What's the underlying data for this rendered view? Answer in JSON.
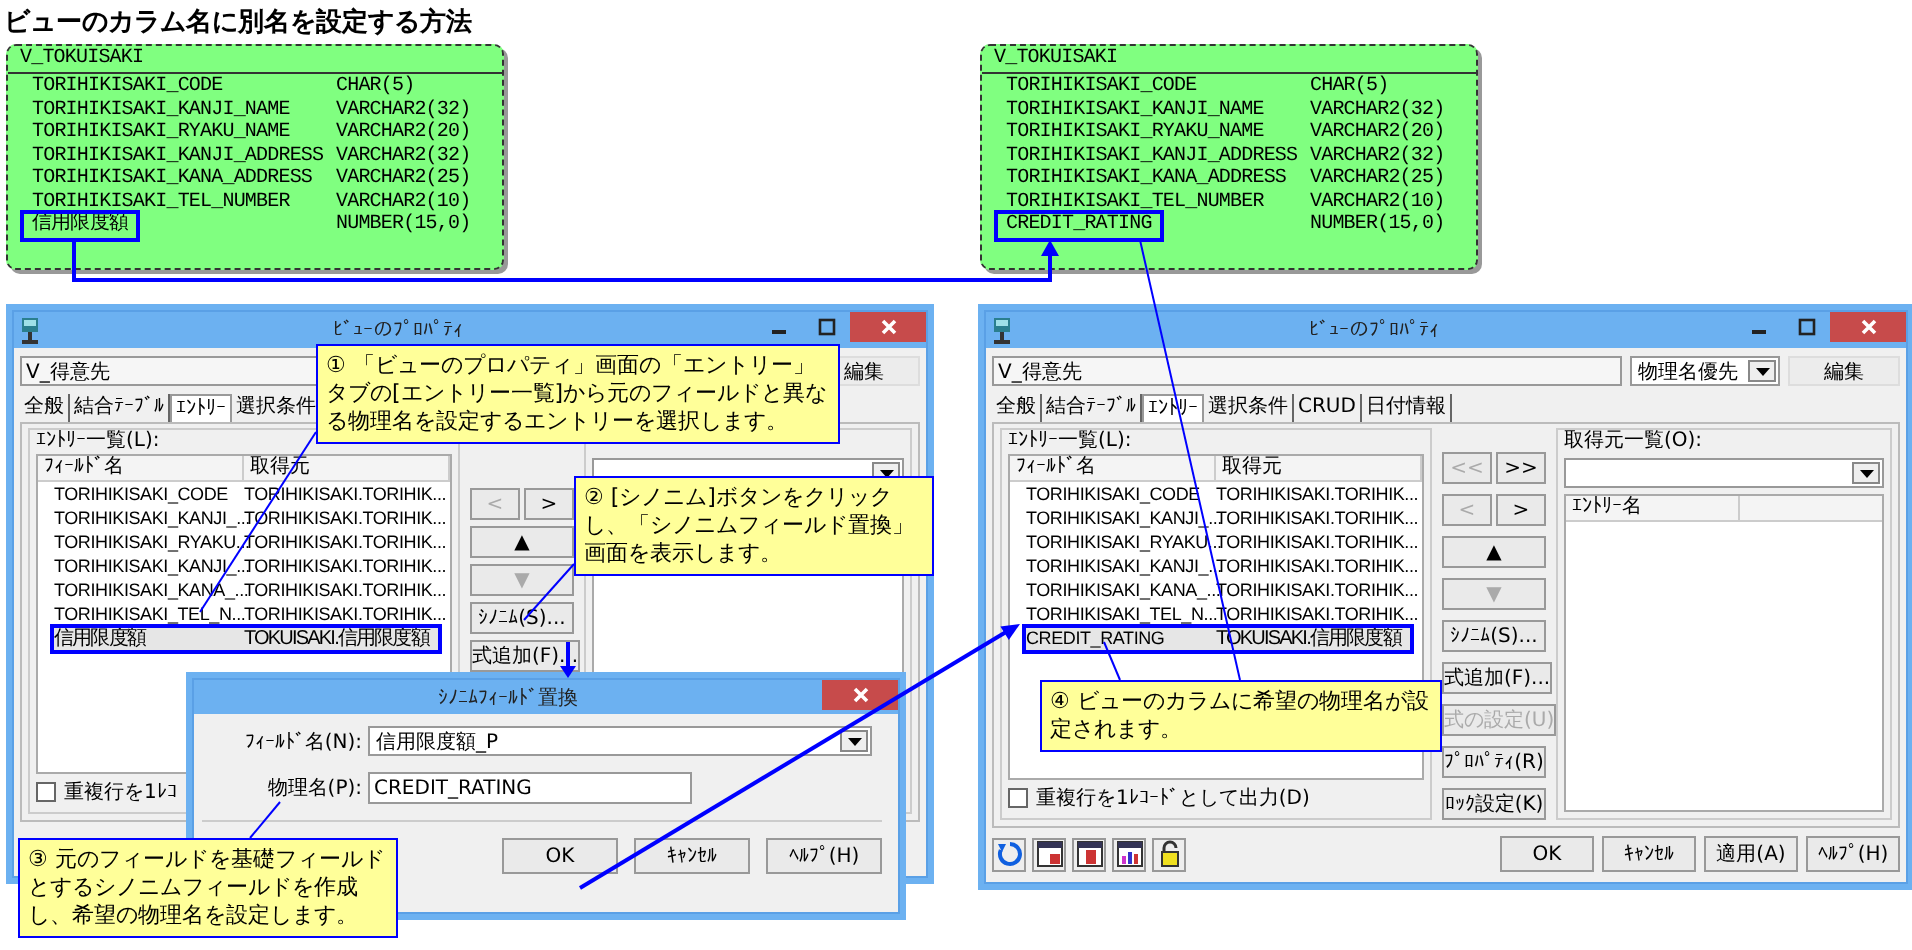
{
  "title": "ビューのカラム名に別名を設定する方法",
  "er_tables": [
    {
      "name": "V_TOKUISAKI",
      "columns": [
        {
          "name": "TORIHIKISAKI_CODE",
          "type": "CHAR(5)",
          "highlighted": false
        },
        {
          "name": "TORIHIKISAKI_KANJI_NAME",
          "type": "VARCHAR2(32)",
          "highlighted": false
        },
        {
          "name": "TORIHIKISAKI_RYAKU_NAME",
          "type": "VARCHAR2(20)",
          "highlighted": false
        },
        {
          "name": "TORIHIKISAKI_KANJI_ADDRESS",
          "type": "VARCHAR2(32)",
          "highlighted": false
        },
        {
          "name": "TORIHIKISAKI_KANA_ADDRESS",
          "type": "VARCHAR2(25)",
          "highlighted": false
        },
        {
          "name": "TORIHIKISAKI_TEL_NUMBER",
          "type": "VARCHAR2(10)",
          "highlighted": false
        },
        {
          "name": "信用限度額",
          "type": "NUMBER(15,0)",
          "highlighted": true
        }
      ]
    },
    {
      "name": "V_TOKUISAKI",
      "columns": [
        {
          "name": "TORIHIKISAKI_CODE",
          "type": "CHAR(5)",
          "highlighted": false
        },
        {
          "name": "TORIHIKISAKI_KANJI_NAME",
          "type": "VARCHAR2(32)",
          "highlighted": false
        },
        {
          "name": "TORIHIKISAKI_RYAKU_NAME",
          "type": "VARCHAR2(20)",
          "highlighted": false
        },
        {
          "name": "TORIHIKISAKI_KANJI_ADDRESS",
          "type": "VARCHAR2(32)",
          "highlighted": false
        },
        {
          "name": "TORIHIKISAKI_KANA_ADDRESS",
          "type": "VARCHAR2(25)",
          "highlighted": false
        },
        {
          "name": "TORIHIKISAKI_TEL_NUMBER",
          "type": "VARCHAR2(10)",
          "highlighted": false
        },
        {
          "name": "CREDIT_RATING",
          "type": "NUMBER(15,0)",
          "highlighted": true
        }
      ]
    }
  ],
  "dialogs": [
    {
      "title": "ﾋﾞｭｰのﾌﾟﾛﾊﾟﾃｨ",
      "view_name": "V_得意先",
      "edit_button": "編集",
      "tabs": [
        {
          "label": "全般",
          "selected": false
        },
        {
          "label": "結合ﾃｰﾌﾞﾙ",
          "selected": false
        },
        {
          "label": "ｴﾝﾄﾘｰ",
          "selected": true
        },
        {
          "label": "選択条件",
          "selected": false
        }
      ],
      "entry_group": {
        "label": "ｴﾝﾄﾘｰ一覧(L):",
        "columns": [
          "ﾌｨｰﾙﾄﾞ名",
          "取得元"
        ],
        "rows": [
          {
            "field": "TORIHIKISAKI_CODE",
            "source": "TORIHIKISAKI.TORIHIK...",
            "selected": false,
            "highlighted": false
          },
          {
            "field": "TORIHIKISAKI_KANJI_...",
            "source": "TORIHIKISAKI.TORIHIK...",
            "selected": false,
            "highlighted": false
          },
          {
            "field": "TORIHIKISAKI_RYAKU...",
            "source": "TORIHIKISAKI.TORIHIK...",
            "selected": false,
            "highlighted": false
          },
          {
            "field": "TORIHIKISAKI_KANJI_...",
            "source": "TORIHIKISAKI.TORIHIK...",
            "selected": false,
            "highlighted": false
          },
          {
            "field": "TORIHIKISAKI_KANA_...",
            "source": "TORIHIKISAKI.TORIHIK...",
            "selected": false,
            "highlighted": false
          },
          {
            "field": "TORIHIKISAKI_TEL_N...",
            "source": "TORIHIKISAKI.TORIHIK...",
            "selected": false,
            "highlighted": false
          },
          {
            "field": "信用限度額",
            "source": "TOKUISAKI.信用限度額",
            "selected": true,
            "highlighted": true
          }
        ],
        "checkbox": {
          "label": "重複行を1ﾚｺ",
          "checked": false
        }
      },
      "button_rows": [
        {
          "buttons": [
            {
              "label": "<",
              "disabled": true
            },
            {
              "label": ">",
              "disabled": false
            }
          ]
        },
        {
          "buttons": [
            {
              "label": "▲",
              "disabled": false
            }
          ]
        },
        {
          "buttons": [
            {
              "label": "▼",
              "disabled": true
            }
          ]
        },
        {
          "buttons": [
            {
              "label": "ｼﾉﾆﾑ(S)...",
              "disabled": false
            }
          ]
        },
        {
          "buttons": [
            {
              "label": "式追加(F)...",
              "disabled": false
            }
          ]
        }
      ]
    },
    {
      "title": "ﾋﾞｭｰのﾌﾟﾛﾊﾟﾃｨ",
      "view_name": "V_得意先",
      "mode": "物理名優先",
      "edit_button": "編集",
      "tabs": [
        {
          "label": "全般",
          "selected": false
        },
        {
          "label": "結合ﾃｰﾌﾞﾙ",
          "selected": false
        },
        {
          "label": "ｴﾝﾄﾘｰ",
          "selected": true
        },
        {
          "label": "選択条件",
          "selected": false
        },
        {
          "label": "CRUD",
          "selected": false
        },
        {
          "label": "日付情報",
          "selected": false
        }
      ],
      "entry_group": {
        "label": "ｴﾝﾄﾘｰ一覧(L):",
        "columns": [
          "ﾌｨｰﾙﾄﾞ名",
          "取得元"
        ],
        "rows": [
          {
            "field": "TORIHIKISAKI_CODE",
            "source": "TORIHIKISAKI.TORIHIK...",
            "selected": false,
            "highlighted": false
          },
          {
            "field": "TORIHIKISAKI_KANJI_...",
            "source": "TORIHIKISAKI.TORIHIK...",
            "selected": false,
            "highlighted": false
          },
          {
            "field": "TORIHIKISAKI_RYAKU...",
            "source": "TORIHIKISAKI.TORIHIK...",
            "selected": false,
            "highlighted": false
          },
          {
            "field": "TORIHIKISAKI_KANJI_...",
            "source": "TORIHIKISAKI.TORIHIK...",
            "selected": false,
            "highlighted": false
          },
          {
            "field": "TORIHIKISAKI_KANA_...",
            "source": "TORIHIKISAKI.TORIHIK...",
            "selected": false,
            "highlighted": false
          },
          {
            "field": "TORIHIKISAKI_TEL_N...",
            "source": "TORIHIKISAKI.TORIHIK...",
            "selected": false,
            "highlighted": false
          },
          {
            "field": "CREDIT_RATING",
            "source": "TOKUISAKI.信用限度額",
            "selected": true,
            "highlighted": true
          }
        ],
        "checkbox": {
          "label": "重複行を1ﾚｺｰﾄﾞとして出力(D)",
          "checked": false
        }
      },
      "button_rows": [
        {
          "buttons": [
            {
              "label": "<<",
              "disabled": true
            },
            {
              "label": ">>",
              "disabled": false
            }
          ]
        },
        {
          "buttons": [
            {
              "label": "<",
              "disabled": true
            },
            {
              "label": ">",
              "disabled": false
            }
          ]
        },
        {
          "buttons": [
            {
              "label": "▲",
              "disabled": false
            }
          ]
        },
        {
          "buttons": [
            {
              "label": "▼",
              "disabled": true
            }
          ]
        },
        {
          "buttons": [
            {
              "label": "ｼﾉﾆﾑ(S)...",
              "disabled": false
            }
          ]
        },
        {
          "buttons": [
            {
              "label": "式追加(F)...",
              "disabled": false
            }
          ]
        },
        {
          "buttons": [
            {
              "label": "式の設定(U)",
              "disabled": true
            }
          ]
        },
        {
          "buttons": [
            {
              "label": "ﾌﾟﾛﾊﾟﾃｨ(R)",
              "disabled": false
            }
          ]
        },
        {
          "buttons": [
            {
              "label": "ﾛｯｸ設定(K)",
              "disabled": false
            }
          ]
        }
      ],
      "source_group": {
        "label": "取得元一覧(O):",
        "header": "ｴﾝﾄﾘｰ名"
      },
      "buttons": [
        "OK",
        "ｷｬﾝｾﾙ",
        "適用(A)",
        "ﾍﾙﾌﾟ(H)"
      ]
    }
  ],
  "synonym_dialog": {
    "title": "ｼﾉﾆﾑﾌｨｰﾙﾄﾞ置換",
    "fields": [
      {
        "kind": "combo",
        "label": "ﾌｨｰﾙﾄﾞ名(N):",
        "value": "信用限度額_P"
      },
      {
        "kind": "text",
        "label": "物理名(P):",
        "value": "CREDIT_RATING"
      }
    ],
    "buttons": [
      "OK",
      "ｷｬﾝｾﾙ",
      "ﾍﾙﾌﾟ(H)"
    ]
  },
  "callouts": [
    {
      "text": "① 「ビューのプロパティ」画面の「エントリー」タブの[エントリー一覧]から元のフィールドと異なる物理名を設定するエントリーを選択します。"
    },
    {
      "text": "② [シノニム]ボタンをクリックし、「シノニムフィールド置換」画面を表示します。"
    },
    {
      "text": "③ 元のフィールドを基礎フィールドとするシノニムフィールドを作成し、希望の物理名を設定します。"
    },
    {
      "text": "④ ビューのカラムに希望の物理名が設定されます。"
    }
  ]
}
